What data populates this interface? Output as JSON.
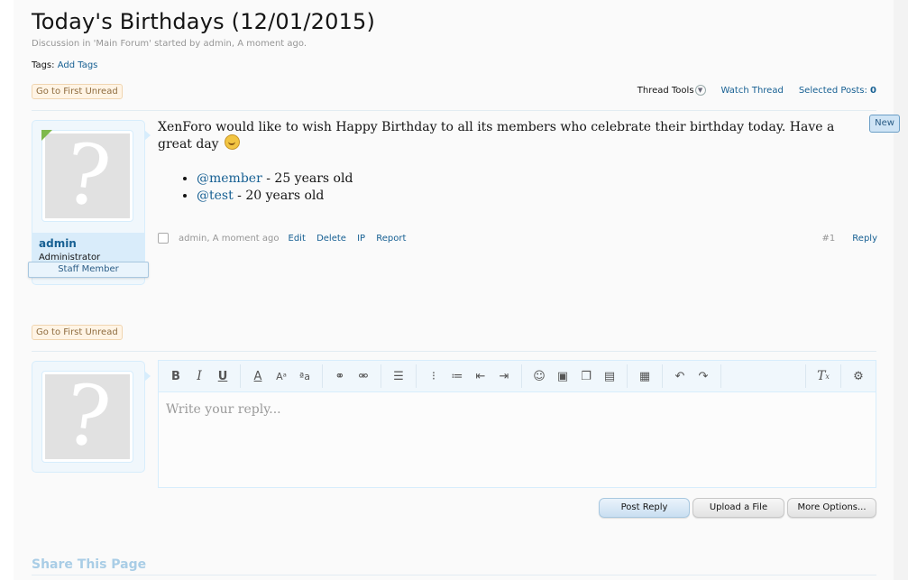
{
  "thread": {
    "title": "Today's Birthdays (12/01/2015)",
    "meta": "Discussion in 'Main Forum' started by admin, A moment ago.",
    "tags_label": "Tags:",
    "add_tags": "Add Tags",
    "go_first_unread": "Go to First Unread",
    "tools": {
      "thread_tools": "Thread Tools",
      "watch_thread": "Watch Thread",
      "selected_posts_label": "Selected Posts:",
      "selected_posts_count": "0"
    }
  },
  "post": {
    "username": "admin",
    "user_title": "Administrator",
    "staff_banner": "Staff Member",
    "new_badge": "New",
    "message": "XenForo would like to wish Happy Birthday to all its members who celebrate their birthday today. Have a great day",
    "birthdays": [
      {
        "mention": "@member",
        "age": " - 25 years old"
      },
      {
        "mention": "@test",
        "age": " - 20 years old"
      }
    ],
    "author_time": "admin, A moment ago",
    "actions": [
      "Edit",
      "Delete",
      "IP",
      "Report"
    ],
    "post_number": "#1",
    "reply": "Reply"
  },
  "editor": {
    "placeholder": "Write your reply...",
    "buttons": {
      "post_reply": "Post Reply",
      "upload_file": "Upload a File",
      "more_options": "More Options..."
    }
  },
  "share": {
    "title": "Share This Page"
  },
  "colors": {
    "link": "#176093",
    "panel_bg": "#f0f7fc",
    "unread_button_bg": "#fff4e5",
    "online_marker": "#7fb94c"
  }
}
